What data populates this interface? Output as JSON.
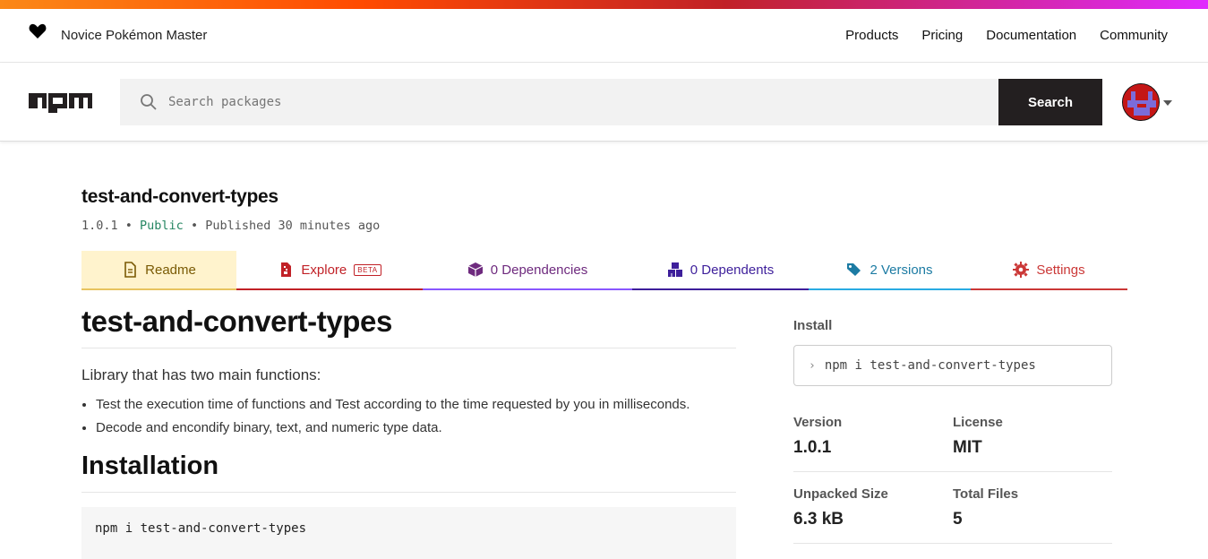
{
  "topbar": {
    "tagline": "Novice Pokémon Master",
    "nav": [
      "Products",
      "Pricing",
      "Documentation",
      "Community"
    ]
  },
  "search": {
    "placeholder": "Search packages",
    "button_label": "Search"
  },
  "package": {
    "name": "test-and-convert-types",
    "version": "1.0.1",
    "visibility": "Public",
    "published": "Published 30 minutes ago"
  },
  "tabs": {
    "readme": "Readme",
    "explore": "Explore",
    "beta": "BETA",
    "dependencies": "0 Dependencies",
    "dependents": "0 Dependents",
    "versions": "2 Versions",
    "settings": "Settings"
  },
  "readme": {
    "title": "test-and-convert-types",
    "intro": "Library that has two main functions:",
    "bullets": [
      "Test the execution time of functions and Test according to the time requested by you in milliseconds.",
      "Decode and encondify binary, text, and numeric type data."
    ],
    "installation_heading": "Installation",
    "install_code": "npm i test-and-convert-types"
  },
  "sidebar": {
    "install_label": "Install",
    "install_command": "npm i test-and-convert-types",
    "version_label": "Version",
    "version_value": "1.0.1",
    "license_label": "License",
    "license_value": "MIT",
    "unpacked_label": "Unpacked Size",
    "unpacked_value": "6.3 kB",
    "files_label": "Total Files",
    "files_value": "5"
  },
  "colors": {
    "readme_tab": "#fff3cd",
    "search_button": "#231f20",
    "public_green": "#258662"
  },
  "icons": [
    "heart-icon",
    "npm-logo",
    "search-icon",
    "avatar",
    "file-icon",
    "explore-icon",
    "box-icon",
    "boxes-icon",
    "tags-icon",
    "gear-icon"
  ]
}
